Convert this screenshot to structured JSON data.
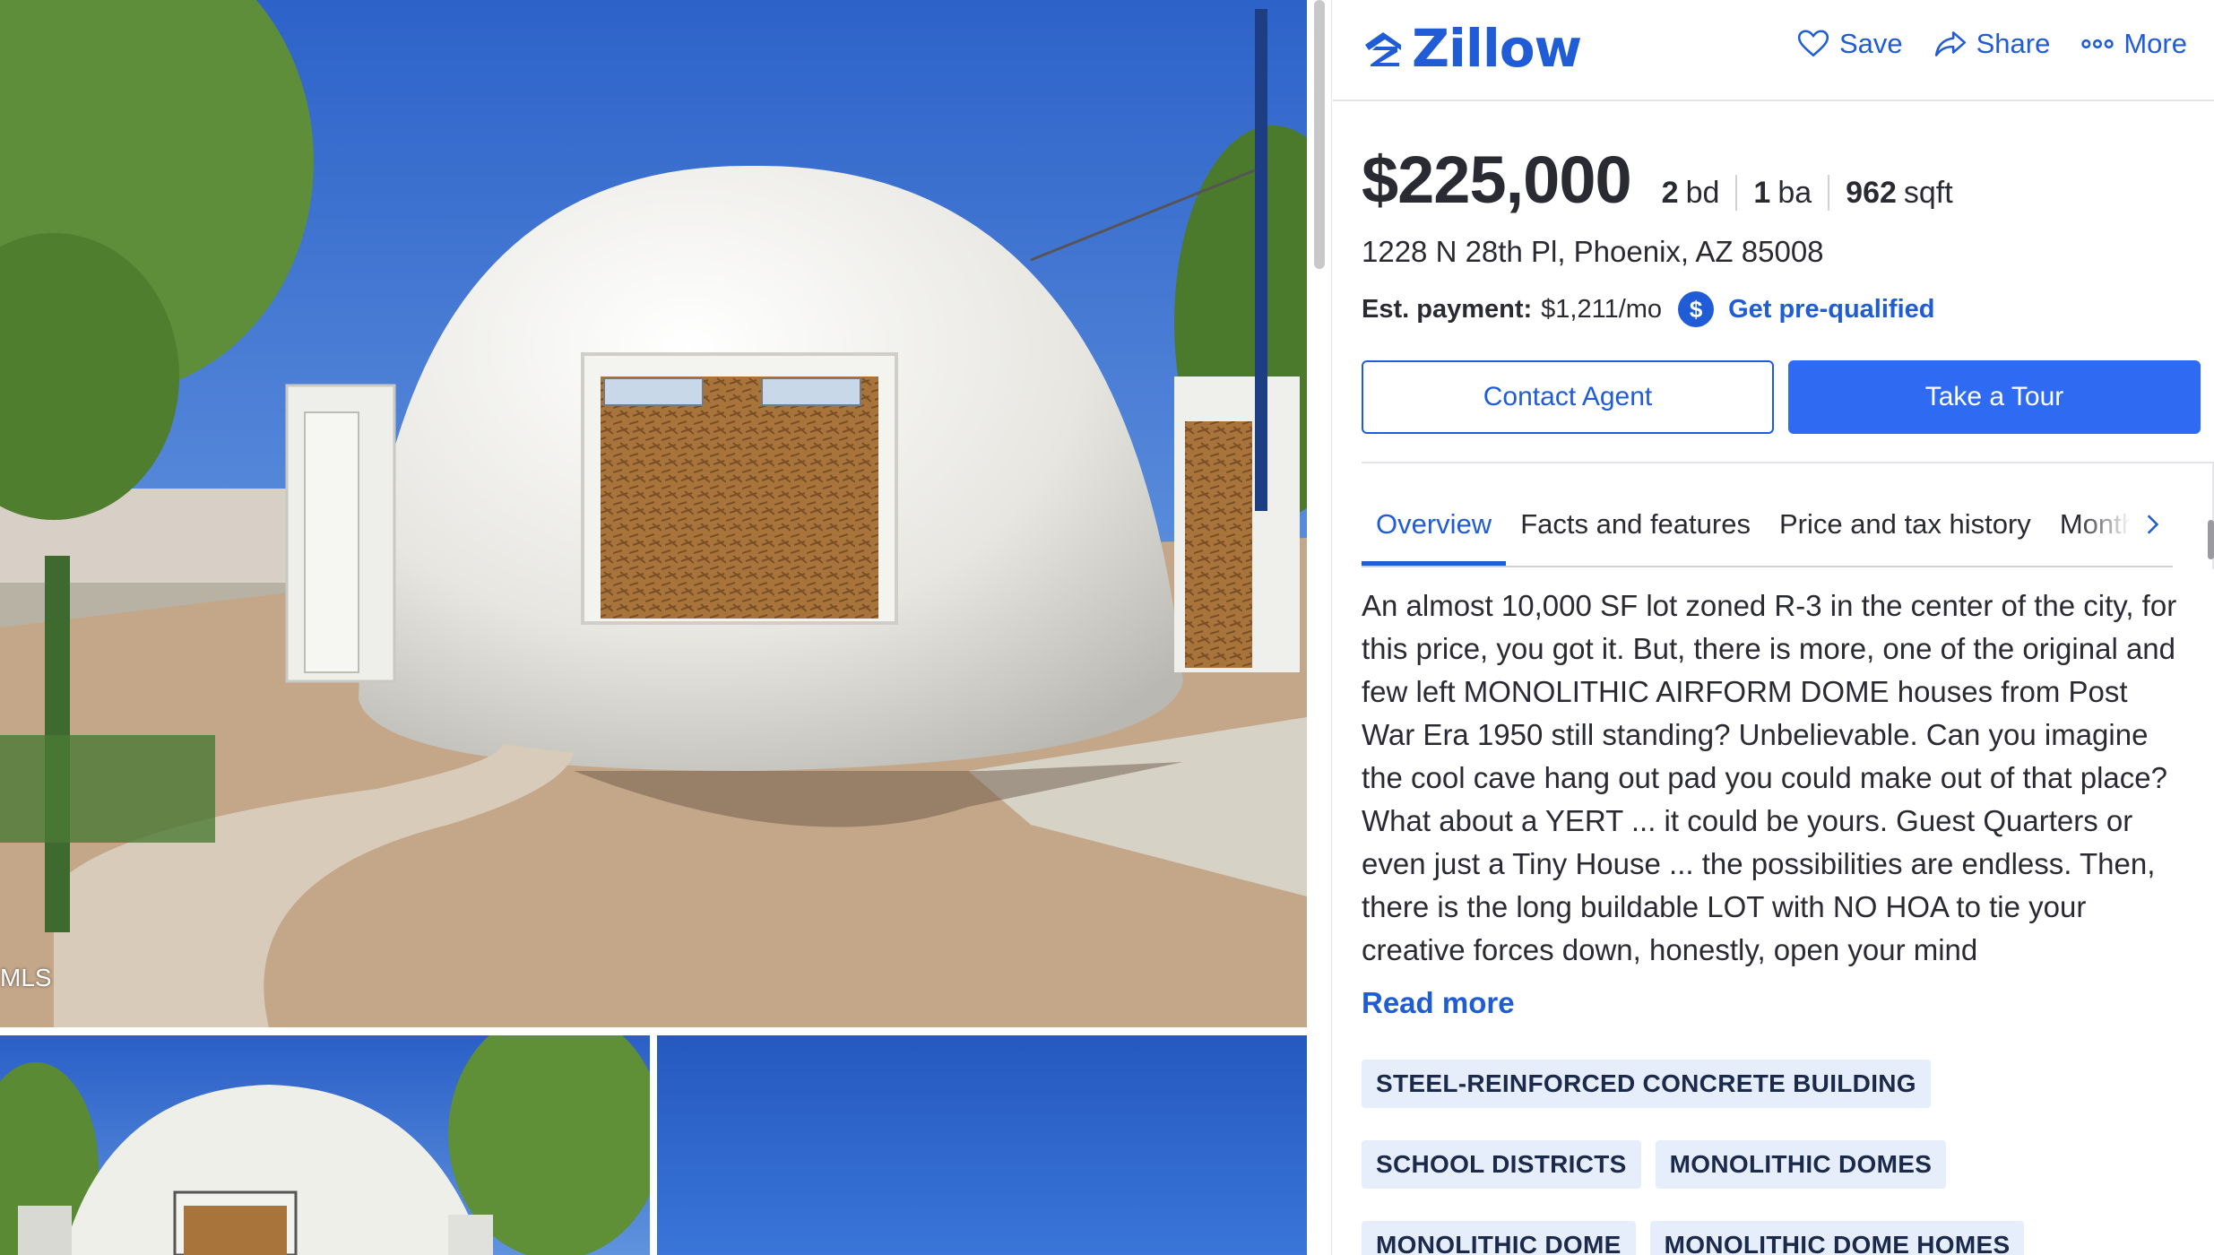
{
  "gallery": {
    "watermark": "MLS",
    "photos": [
      "dome-front-exterior",
      "dome-side-exterior",
      "sky"
    ]
  },
  "header": {
    "brand": "Zillow",
    "actions": [
      {
        "label": "Save",
        "icon": "heart-icon"
      },
      {
        "label": "Share",
        "icon": "share-icon"
      },
      {
        "label": "More",
        "icon": "more-dots-icon"
      }
    ]
  },
  "listing": {
    "price": "$225,000",
    "beds_value": "2",
    "beds_unit": "bd",
    "baths_value": "1",
    "baths_unit": "ba",
    "sqft_value": "962",
    "sqft_unit": "sqft",
    "address": "1228 N 28th Pl, Phoenix, AZ 85008",
    "payment_label": "Est. payment:",
    "payment_amount": "$1,211/mo",
    "prequal_label": "Get pre-qualified"
  },
  "buttons": {
    "contact": "Contact Agent",
    "tour": "Take a Tour"
  },
  "tabs": [
    {
      "label": "Overview",
      "active": true
    },
    {
      "label": "Facts and features",
      "active": false
    },
    {
      "label": "Price and tax history",
      "active": false
    },
    {
      "label": "Monthly payment",
      "active": false
    }
  ],
  "description": "An almost 10,000 SF lot zoned R-3 in the center of the city, for this price, you got it.  But, there is more, one of the original and few left MONOLITHIC AIRFORM DOME houses from Post War Era 1950 still standing?  Unbelievable.  Can you imagine the cool cave hang out pad you could make out of that place?  What about a YERT ... it could be yours.  Guest Quarters or even just a Tiny House ... the possibilities are endless.  Then, there is the long buildable LOT with NO HOA to tie your creative forces down, honestly, open your mind",
  "read_more": "Read more",
  "tags": [
    "STEEL-REINFORCED CONCRETE BUILDING",
    "SCHOOL DISTRICTS",
    "MONOLITHIC DOMES",
    "MONOLITHIC DOME",
    "MONOLITHIC DOME HOMES"
  ],
  "colors": {
    "brand_blue": "#1f5cd6",
    "button_blue": "#2f6bf2",
    "chip_bg": "#e6eefb",
    "text": "#2a2a33"
  }
}
